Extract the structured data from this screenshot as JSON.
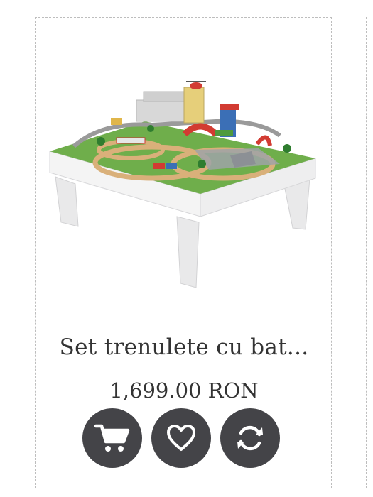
{
  "product": {
    "title": "Set trenulete cu bat...",
    "price": "1,699.00 RON",
    "image": {
      "icon": "train-table-photo",
      "colors": {
        "table": "#f4f4f4",
        "legs": "#e9e9ea",
        "grass": "#6fae4b",
        "track": "#d9b07a",
        "building": "#d8d8d8",
        "red": "#d23b32",
        "blue": "#3b6fb6"
      }
    }
  },
  "actions": [
    {
      "name": "add-to-cart-button",
      "icon": "cart-icon"
    },
    {
      "name": "add-to-wishlist-button",
      "icon": "heart-icon"
    },
    {
      "name": "compare-button",
      "icon": "refresh-icon"
    }
  ],
  "theme": {
    "button_color": "#444448",
    "icon_color": "#ffffff",
    "text_color": "#333333",
    "border_color": "#bdbdbd"
  }
}
